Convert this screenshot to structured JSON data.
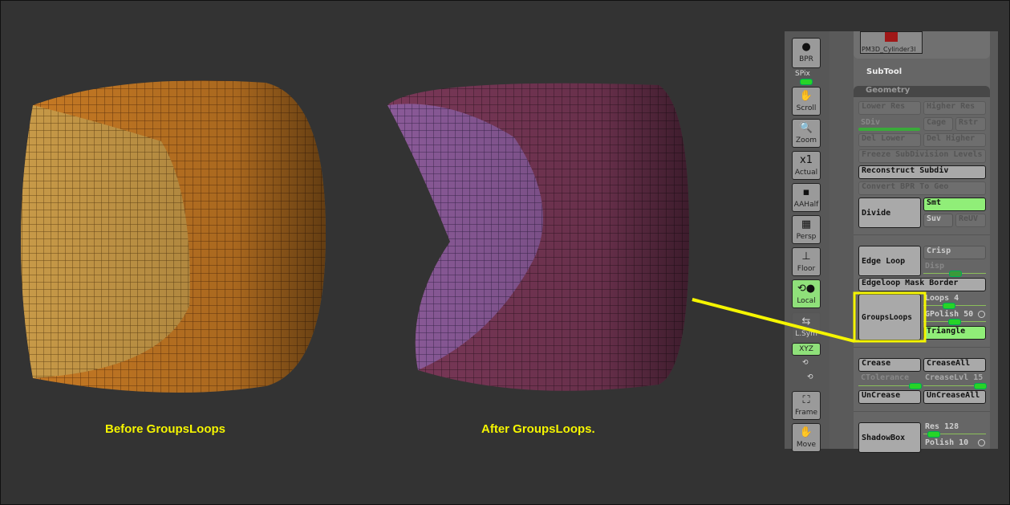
{
  "captions": {
    "before": "Before GroupsLoops",
    "after": "After GroupsLoops."
  },
  "colors": {
    "highlight": "#f5f500",
    "before_mesh": "#c8781e",
    "after_mesh": "#7a3a5a",
    "green": "#90ee78"
  },
  "toolbar": {
    "bpr": "BPR",
    "spix": "SPix",
    "scroll": "Scroll",
    "zoom": "Zoom",
    "actual": "Actual",
    "aahalf": "AAHalf",
    "persp": "Persp",
    "floor": "Floor",
    "local": "Local",
    "lsym": "L.Sym",
    "xyz": "XYZ",
    "frame": "Frame",
    "move": "Move"
  },
  "panel": {
    "thumbnail_label": "PM3D_Cylinder3l",
    "subtool": "SubTool",
    "geometry": "Geometry",
    "lower_res": "Lower Res",
    "higher_res": "Higher Res",
    "sdiv": "SDiv",
    "cage": "Cage",
    "rstr": "Rstr",
    "del_lower": "Del Lower",
    "del_higher": "Del Higher",
    "freeze": "Freeze SubDivision Levels",
    "reconstruct": "Reconstruct Subdiv",
    "convert_bpr": "Convert BPR To Geo",
    "divide": "Divide",
    "smt": "Smt",
    "suv": "Suv",
    "reuv": "ReUV",
    "edge_loop": "Edge Loop",
    "crisp": "Crisp",
    "disp": "Disp",
    "edgeloop_mask_border": "Edgeloop Mask Border",
    "groupsloops": "GroupsLoops",
    "loops": "Loops 4",
    "gpolish": "GPolish 50",
    "triangle": "Triangle",
    "crease": "Crease",
    "crease_all": "CreaseAll",
    "ctolerance": "CTolerance",
    "crease_lvl": "CreaseLvl 15",
    "uncrease": "UnCrease",
    "uncrease_all": "UnCreaseAll",
    "shadowbox": "ShadowBox",
    "res": "Res 128",
    "polish": "Polish 10"
  }
}
